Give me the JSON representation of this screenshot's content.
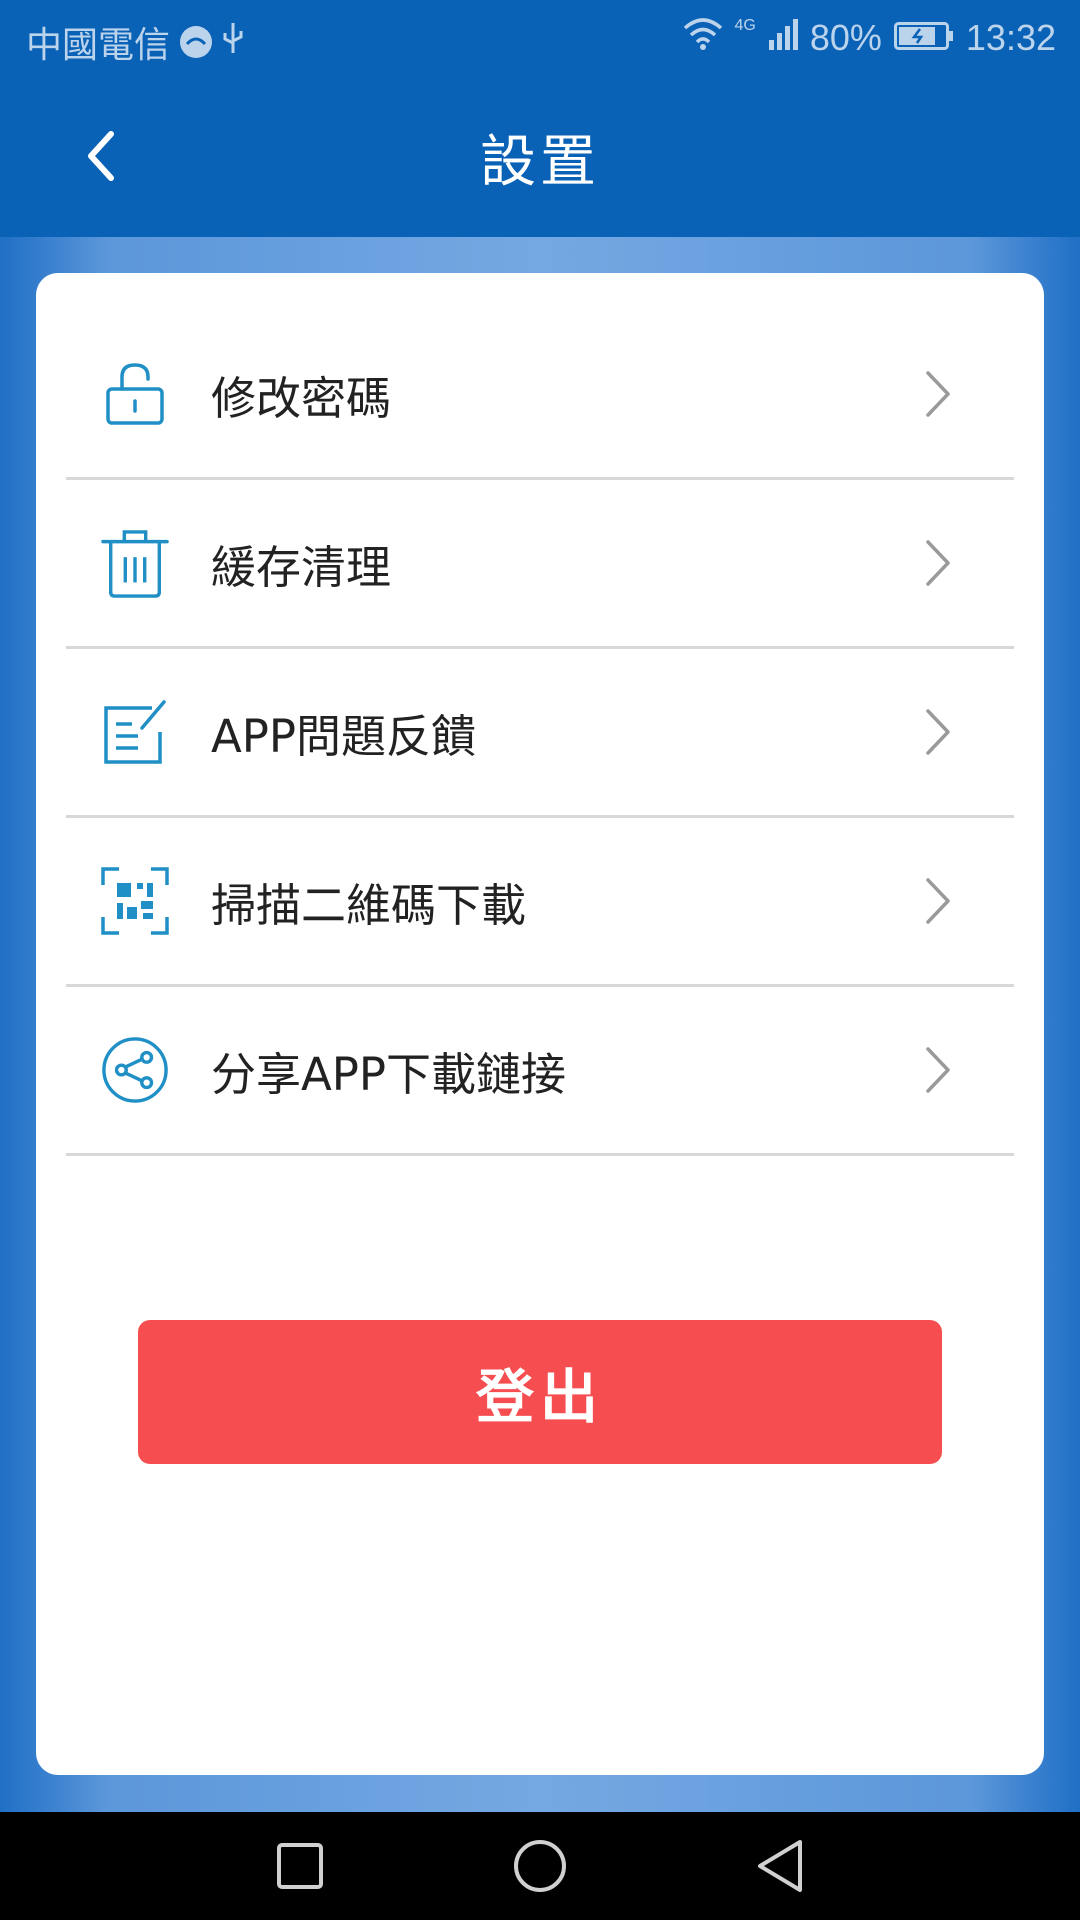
{
  "status_bar": {
    "carrier": "中國電信",
    "signal_type": "4G",
    "battery": "80%",
    "time": "13:32"
  },
  "header": {
    "title": "設置"
  },
  "menu": {
    "items": [
      {
        "label": "修改密碼",
        "icon": "lock-icon"
      },
      {
        "label": "緩存清理",
        "icon": "trash-icon"
      },
      {
        "label": "APP問題反饋",
        "icon": "feedback-edit-icon"
      },
      {
        "label": "掃描二維碼下載",
        "icon": "qr-code-icon"
      },
      {
        "label": "分享APP下載鏈接",
        "icon": "share-icon"
      }
    ]
  },
  "logout": {
    "label": "登出"
  },
  "colors": {
    "primary": "#0a62b6",
    "icon_accent": "#1f8fc6",
    "logout": "#f54d50"
  }
}
